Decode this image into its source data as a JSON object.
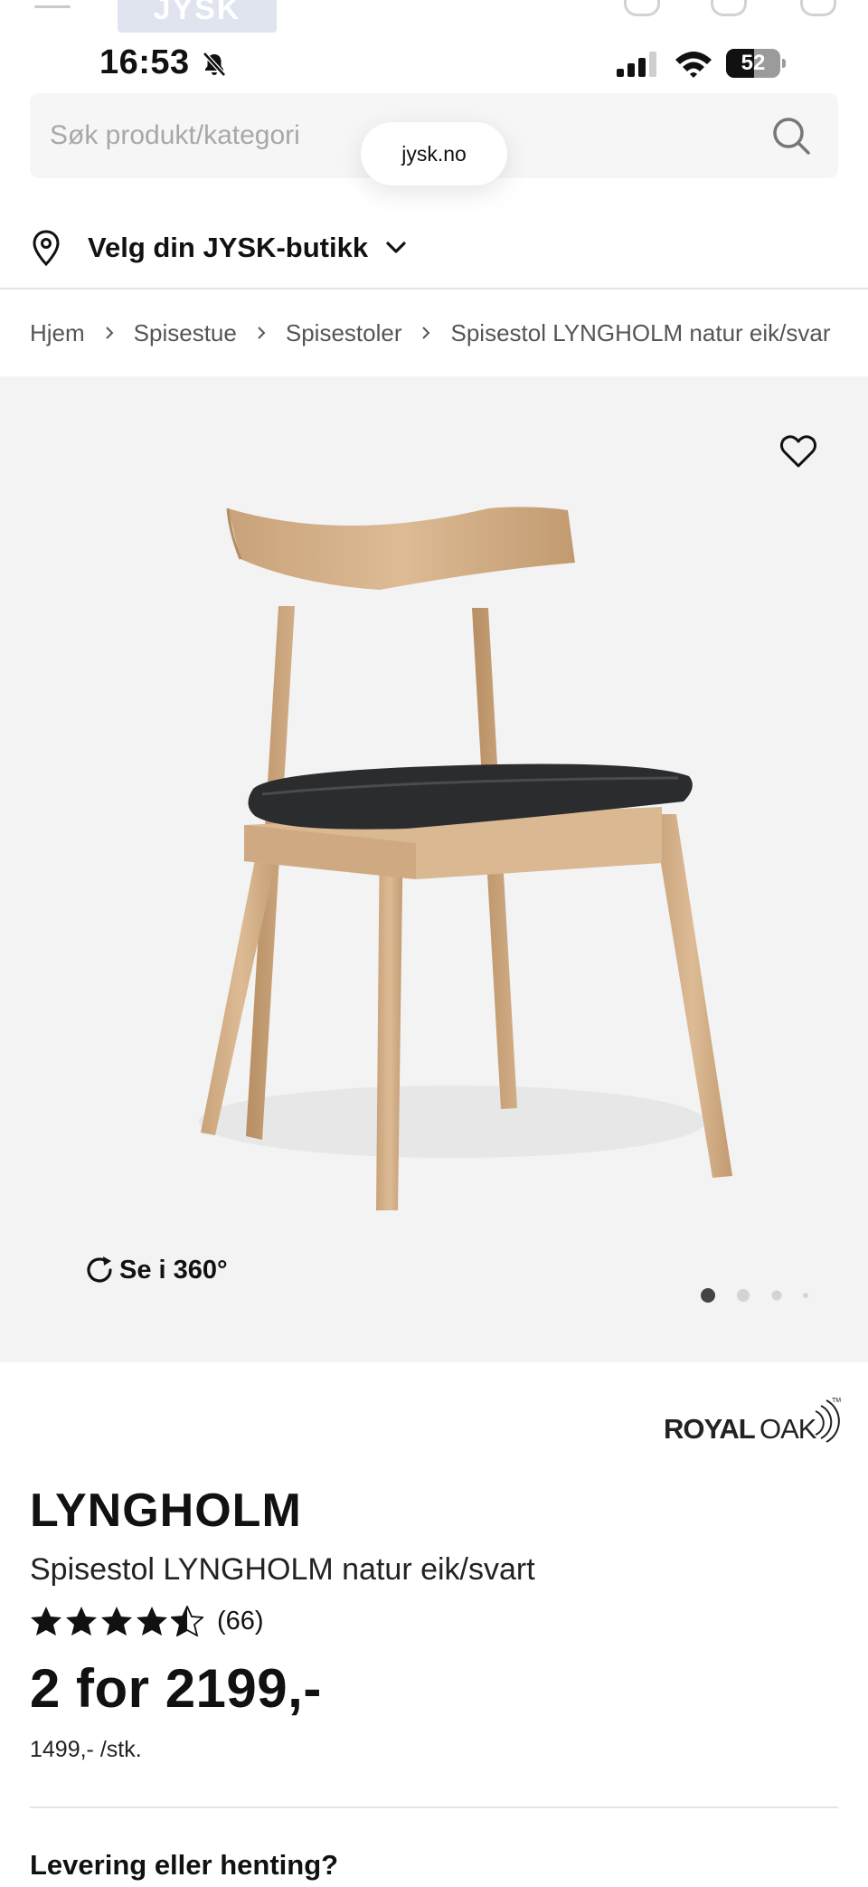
{
  "status_bar": {
    "time": "16:53",
    "battery_level": "52",
    "battery_fraction": 0.52
  },
  "header": {
    "logo_text": "JYSK",
    "icons": [
      "menu-icon",
      "heart-icon",
      "user-icon",
      "cart-icon"
    ]
  },
  "search": {
    "placeholder": "Søk produkt/kategori",
    "url_label": "jysk.no"
  },
  "store_selector": {
    "label": "Velg din JYSK-butikk"
  },
  "breadcrumb": {
    "items": [
      "Hjem",
      "Spisestue",
      "Spisestoler",
      "Spisestol LYNGHOLM natur eik/svar"
    ]
  },
  "gallery": {
    "view360_label": "Se i 360°",
    "image_count": 4,
    "active_index": 0
  },
  "product": {
    "brand": "ROYALOAK",
    "name": "LYNGHOLM",
    "description": "Spisestol LYNGHOLM natur eik/svart",
    "rating": 4.5,
    "review_count": "(66)",
    "price": "2 for 2199,-",
    "unit_price": "1499,- /stk."
  },
  "delivery": {
    "heading": "Levering eller henting?"
  },
  "colors": {
    "text": "#111111",
    "image_background": "#f3f3f4",
    "search_background": "#f6f6f6",
    "divider": "#e4e4e4"
  }
}
